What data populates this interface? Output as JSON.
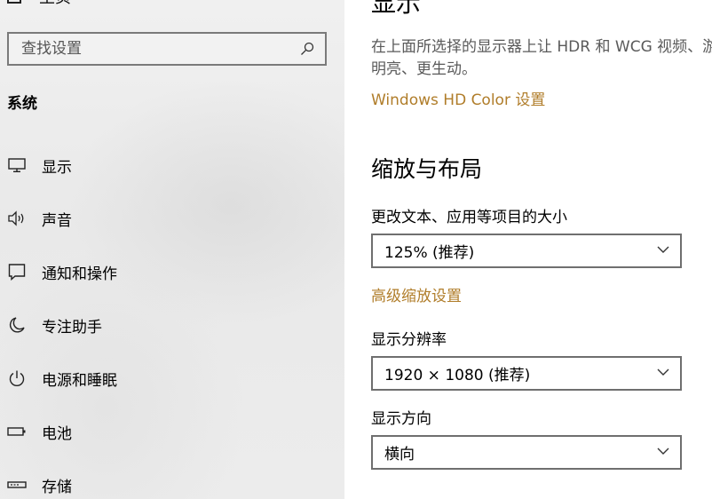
{
  "sidebar": {
    "top_partial_label": "主页",
    "search": {
      "placeholder": "查找设置",
      "value": ""
    },
    "section_title": "系统",
    "items": [
      {
        "label": "显示",
        "icon": "monitor-icon"
      },
      {
        "label": "声音",
        "icon": "speaker-icon"
      },
      {
        "label": "通知和操作",
        "icon": "notification-icon"
      },
      {
        "label": "专注助手",
        "icon": "moon-icon"
      },
      {
        "label": "电源和睡眠",
        "icon": "power-icon"
      },
      {
        "label": "电池",
        "icon": "battery-icon"
      },
      {
        "label": "存储",
        "icon": "storage-icon"
      }
    ]
  },
  "content": {
    "page_heading_partial": "显示",
    "hdr_description": "在上面所选择的显示器上让 HDR 和 WCG 视频、游戏和应用更明亮、更生动。",
    "hdr_description_line1": "在上面所选择的显示器上让 HDR 和 WCG 视频、游",
    "hdr_description_line2": "明亮、更生动。",
    "hdr_link": "Windows HD Color 设置",
    "scale_layout_heading": "缩放与布局",
    "scale_label": "更改文本、应用等项目的大小",
    "scale_value": "125% (推荐)",
    "advanced_scaling_link": "高级缩放设置",
    "resolution_label": "显示分辨率",
    "resolution_value": "1920 × 1080 (推荐)",
    "orientation_label": "显示方向",
    "orientation_value": "横向"
  },
  "colors": {
    "accent_link": "#b07d2a",
    "sidebar_bg": "#ececec",
    "content_bg": "#ffffff"
  }
}
